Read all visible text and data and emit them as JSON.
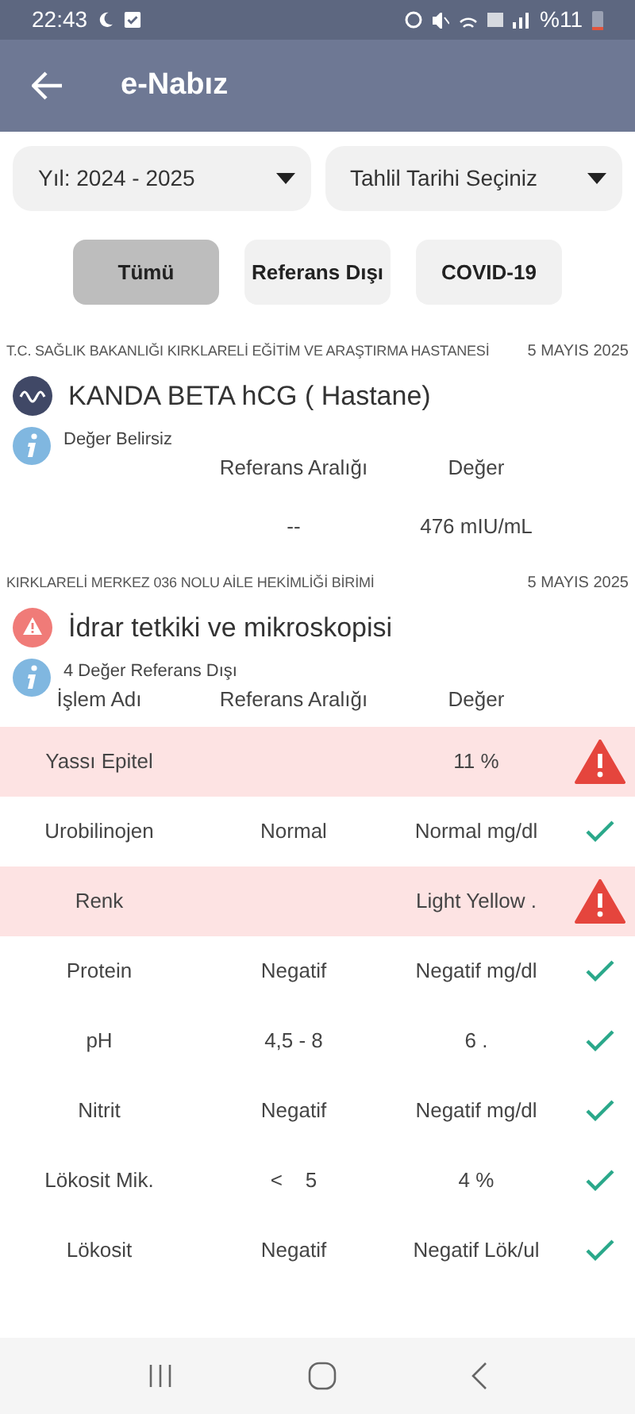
{
  "status_bar": {
    "time": "22:43",
    "battery": "%11"
  },
  "app_bar": {
    "title": "e-Nabız"
  },
  "filters": [
    {
      "label": "Yıl: 2024 - 2025"
    },
    {
      "label": "Tahlil Tarihi Seçiniz"
    }
  ],
  "tabs": [
    {
      "label": "Tümü",
      "selected": true
    },
    {
      "label": "Referans Dışı",
      "selected": false
    },
    {
      "label": "COVID-19",
      "selected": false
    }
  ],
  "results": [
    {
      "institution": "T.C. SAĞLIK BAKANLIĞI KIRKLARELİ EĞİTİM VE ARAŞTIRMA HASTANESİ",
      "date": "5 MAYIS 2025",
      "test": "KANDA BETA hCG ( Hastane)",
      "out_of_range": false,
      "note": "Değer Belirsiz",
      "columns": [
        "",
        "Referans Aralığı",
        "Değer"
      ],
      "rows": [
        {
          "name": "",
          "range": "--",
          "value": "476 mIU/mL"
        }
      ]
    },
    {
      "institution": "KIRKLARELİ MERKEZ 036 NOLU AİLE HEKİMLİĞİ BİRİMİ",
      "date": "5 MAYIS 2025",
      "test": "İdrar tetkiki ve mikroskopisi",
      "out_of_range": true,
      "note": "4 Değer Referans Dışı",
      "columns": [
        "İşlem Adı",
        "Referans Aralığı",
        "Değer"
      ],
      "rows": [
        {
          "name": "Yassı Epitel",
          "range": "",
          "value": "11 %",
          "out_of_range": true
        },
        {
          "name": "Urobilinojen",
          "range": "Normal",
          "value": "Normal mg/dl",
          "out_of_range": false
        },
        {
          "name": "Renk",
          "range": "",
          "value": "Light Yellow .",
          "out_of_range": true
        },
        {
          "name": "Protein",
          "range": "Negatif",
          "value": "Negatif mg/dl",
          "out_of_range": false
        },
        {
          "name": "pH",
          "range": "4,5 - 8",
          "value": "6 .",
          "out_of_range": false
        },
        {
          "name": "Nitrit",
          "range": "Negatif",
          "value": "Negatif mg/dl",
          "out_of_range": false
        },
        {
          "name": "Lökosit Mik.",
          "range": "<    5",
          "value": "4 %",
          "out_of_range": false
        },
        {
          "name": "Lökosit",
          "range": "Negatif",
          "value": "Negatif Lök/ul",
          "out_of_range": false
        }
      ]
    }
  ]
}
